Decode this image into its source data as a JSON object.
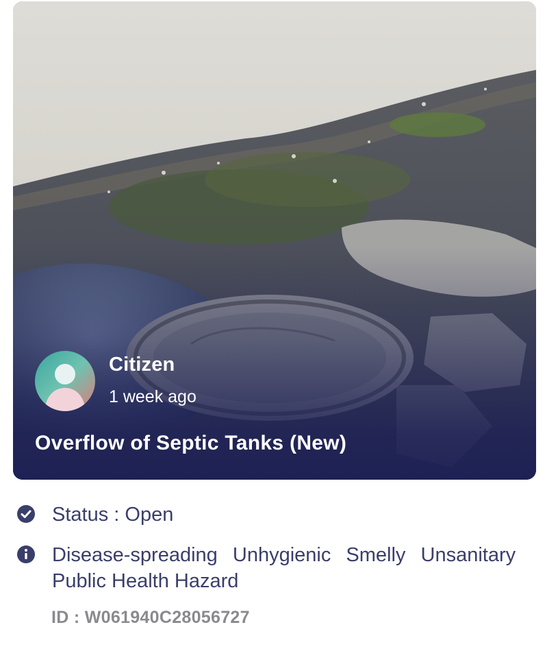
{
  "report": {
    "photo_icon": "overflowing-manhole-photo",
    "author": {
      "name": "Citizen",
      "time": "1 week ago",
      "avatar_icon": "person-silhouette-avatar"
    },
    "title": "Overflow of Septic Tanks (New)"
  },
  "status": {
    "icon": "check-circle-icon",
    "text": "Status : Open"
  },
  "tags": {
    "icon": "info-circle-icon",
    "items": [
      "Disease-spreading",
      "Unhygienic",
      "Smelly",
      "Unsanitary",
      "Public Health Hazard"
    ]
  },
  "id_text": "ID : W061940C28056727",
  "colors": {
    "accent": "#3a3e6b",
    "overlay": "#1c1f54",
    "muted": "#8a8a8e"
  }
}
